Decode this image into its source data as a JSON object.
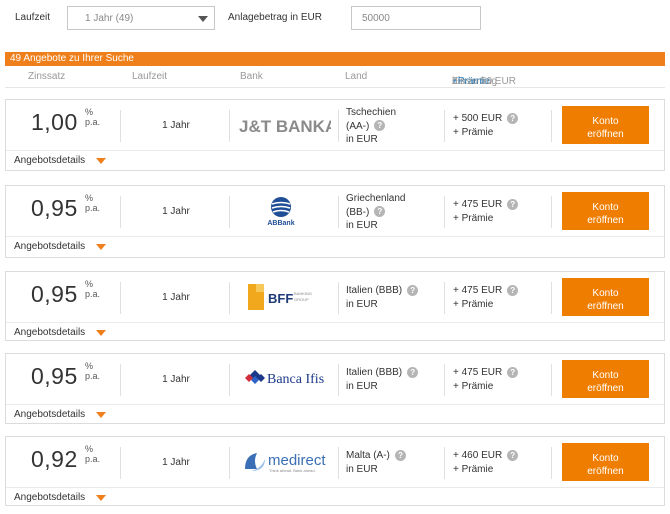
{
  "filters": {
    "laufzeit_label": "Laufzeit",
    "laufzeit_value": "1 Jahr (49)",
    "anlage_label": "Anlagebetrag in EUR",
    "anlage_value": "50000"
  },
  "results": {
    "count_text": "49 Angebote zu Ihrer Suche"
  },
  "columns": {
    "zinssatz": "Zinssatz",
    "laufzeit": "Laufzeit",
    "bank": "Bank",
    "land": "Land",
    "zinsertrag": "Zinsertrag",
    "praemie": "+Prämie",
    "praemie_suffix": "bis zu 50 EUR"
  },
  "offers": [
    {
      "rate": "1,00",
      "pct": "%",
      "pa": "p.a.",
      "term": "1 Jahr",
      "bank": "J&T BANKA",
      "land_line1": "Tschechien",
      "land_line2": "(AA-)",
      "land_line3": "in EUR",
      "zins_line1": "+ 500  EUR",
      "zins_line2": "+ Prämie",
      "button_line1": "Konto",
      "button_line2": "eröffnen",
      "details": "Angebotsdetails"
    },
    {
      "rate": "0,95",
      "pct": "%",
      "pa": "p.a.",
      "term": "1 Jahr",
      "bank": "ABBank",
      "land_line1": "Griechenland",
      "land_line2": "(BB-)",
      "land_line3": "in EUR",
      "zins_line1": "+ 475  EUR",
      "zins_line2": "+ Prämie",
      "button_line1": "Konto",
      "button_line2": "eröffnen",
      "details": "Angebotsdetails"
    },
    {
      "rate": "0,95",
      "pct": "%",
      "pa": "p.a.",
      "term": "1 Jahr",
      "bank": "BFF",
      "bank_sub1": "BANKING",
      "bank_sub2": "GROUP",
      "land_line1": "Italien  (BBB)",
      "land_line2": "",
      "land_line3": "in EUR",
      "zins_line1": "+ 475  EUR",
      "zins_line2": "+ Prämie",
      "button_line1": "Konto",
      "button_line2": "eröffnen",
      "details": "Angebotsdetails"
    },
    {
      "rate": "0,95",
      "pct": "%",
      "pa": "p.a.",
      "term": "1 Jahr",
      "bank": "Banca Ifis",
      "land_line1": "Italien  (BBB)",
      "land_line2": "",
      "land_line3": "in EUR",
      "zins_line1": "+ 475  EUR",
      "zins_line2": "+ Prämie",
      "button_line1": "Konto",
      "button_line2": "eröffnen",
      "details": "Angebotsdetails"
    },
    {
      "rate": "0,92",
      "pct": "%",
      "pa": "p.a.",
      "term": "1 Jahr",
      "bank": "medirect",
      "bank_sub1": "Think ahead. Bank ahead.",
      "land_line1": "Malta  (A-)",
      "land_line2": "",
      "land_line3": "in EUR",
      "zins_line1": "+ 460  EUR",
      "zins_line2": "+ Prämie",
      "button_line1": "Konto",
      "button_line2": "eröffnen",
      "details": "Angebotsdetails"
    }
  ],
  "icons": {
    "help": "question-circle-icon",
    "expand": "caret-down-icon",
    "select": "chevron-down-icon"
  },
  "colors": {
    "accent": "#ef7f1a",
    "button": "#ef7d00",
    "link": "#1c7dc4"
  }
}
